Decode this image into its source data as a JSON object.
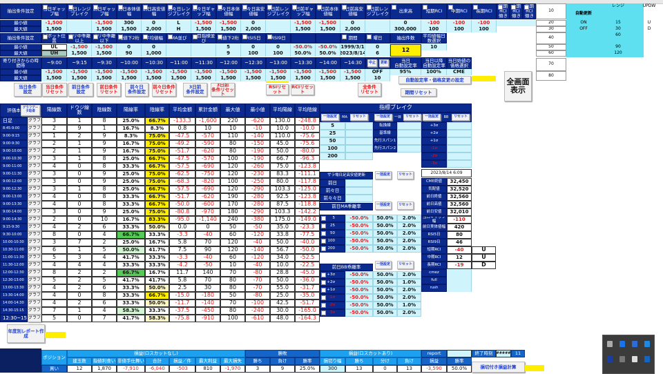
{
  "top": {
    "min_label": "最小値",
    "max_label": "最大値",
    "cond1": {
      "label": "抽出条件設定",
      "headers": [
        "当日ギャップ幅",
        "当日レンジブレイク",
        "前日ギャップ幅",
        "前日本体値幅",
        "前日高安値幅",
        "前々日レンジブレイク",
        "前々日ギャップ幅",
        "前々日本体値幅",
        "前々日高安値幅",
        "3日前レンジブレイク",
        "3日前ギャップ幅",
        "3日前本体値幅",
        "3日前高安値幅",
        "3日前レンジブレイク",
        "出来高",
        "短期RCI",
        "中期RCI",
        "長期RCI",
        "短期RCI傾き",
        "中期RCI傾き",
        "長期RCI傾き"
      ],
      "min": [
        "-1,500",
        "",
        "-1,500",
        "300",
        "0",
        "L",
        "-1,500",
        "-1,500",
        "0",
        "",
        "-1,500",
        "-1,500",
        "0",
        "",
        "0",
        "-100",
        "-100",
        "-100",
        "",
        "",
        ""
      ],
      "max": [
        "1,500",
        "",
        "1,500",
        "1,500",
        "2,000",
        "H",
        "1,500",
        "1,500",
        "2,000",
        "",
        "1,500",
        "1,500",
        "2,000",
        "",
        "300,000",
        "100",
        "100",
        "100",
        "",
        "",
        ""
      ]
    },
    "cond2": {
      "label": "抽出条件設定",
      "headers": [
        "ピボット位置",
        "ボリ中乖離以上",
        "ボリ中乖離以下",
        "始値下2桁",
        "平均値幅",
        "MA並び",
        "一目指標並び",
        "終値下2桁",
        "RSI5日",
        "RSI9日",
        "",
        "",
        "期間",
        "曜日",
        "抽出件数",
        "平均値幅日数選択"
      ],
      "min": [
        "UL",
        "-1,500",
        "-1,500",
        "0",
        "0",
        "",
        "",
        "5",
        "0",
        "0",
        "-50.0%",
        "-50.0%",
        "1999/3/1",
        "0",
        "12",
        "10"
      ],
      "max": [
        "UH",
        "1,500",
        "1,500",
        "90",
        "1,000",
        "",
        "",
        "9",
        "100",
        "100",
        "50.0%",
        "50.0%",
        "2023/8/14",
        "6",
        "",
        ""
      ]
    },
    "time": {
      "label": "寄り付きからの時間帯",
      "headers": [
        "~9:00",
        "~9:15",
        "~9:30",
        "~10:00",
        "~10:30",
        "~11:00",
        "~11:30",
        "~12:00",
        "~12:30",
        "~13:00",
        "~13:30",
        "~14:00",
        "~14:30"
      ],
      "min": [
        "-1,500",
        "-1,500",
        "-1,500",
        "-1,500",
        "-1,500",
        "-1,500",
        "-1,500",
        "-1,500",
        "-1,500",
        "-1,500",
        "-1,500",
        "-1,500",
        "-1,500"
      ],
      "max": [
        "1,500",
        "1,500",
        "1,500",
        "1,500",
        "1,500",
        "1,500",
        "1,500",
        "1,500",
        "1,500",
        "1,500",
        "1,500",
        "1,500",
        "1,500"
      ],
      "stop_label": "中止",
      "update_label": "更新",
      "switch_value": "OFF",
      "switch_max": "10",
      "auto_today_label": "当日\n自動設定率",
      "auto_today_value": "95%",
      "auto_after_label": "当日以降\n自動設定率",
      "auto_after_value": "100%",
      "open_price_label": "当日始値の価格選択",
      "open_price_value": "CME"
    },
    "buttons": [
      "当日条件\n設定",
      "当日条件\nリセット",
      "前日条件\n設定",
      "前日条件\nリセット",
      "前々日\n条件設定",
      "前々日条件\nリセット",
      "3日前\n条件設定",
      "3日前\n条件リセット",
      "RSIリセット",
      "RCIリセット",
      "全条件\nリセット",
      "自動設定率・価格変更の設定",
      "期間リセット",
      "全画面\n表示"
    ]
  },
  "side": {
    "w_values": [
      "10",
      "20",
      "30",
      "40",
      "50",
      "60",
      "70",
      "80"
    ],
    "auto_update_label": "自動更新",
    "auto_update_options": [
      "ON",
      "OFF"
    ],
    "range_label": "レンジ",
    "range_values": [
      "15",
      "30",
      "60",
      "90",
      "120"
    ],
    "updw_label": "UPDW",
    "updw_values": [
      "U",
      "D"
    ]
  },
  "main": {
    "corner_label": "評価本",
    "graph_data_button": "グラフデータ取得",
    "graph_button": "グラフ",
    "columns": [
      "陽線数",
      "ドウジ線数",
      "陰線数",
      "陽線率",
      "陰線率",
      "平均金額",
      "累計金額",
      "最大値",
      "最小値",
      "平均陽線",
      "平均陰線"
    ],
    "rows": [
      [
        "日足",
        "3",
        "1",
        "8",
        "25.0%",
        "66.7%",
        "-133.3",
        "-1,600",
        "220",
        "-620",
        "130.0",
        "-248.8"
      ],
      [
        "8:45-9:00",
        "2",
        "9",
        "1",
        "16.7%",
        "8.3%",
        "0.8",
        "10",
        "10",
        "-10",
        "10.0",
        "-10.0"
      ],
      [
        "9:00-9:15",
        "1",
        "2",
        "9",
        "8.3%",
        "75.0%",
        "-47.5",
        "-570",
        "110",
        "-140",
        "110.0",
        "-75.6"
      ],
      [
        "9:00-9:30",
        "2",
        "1",
        "9",
        "16.7%",
        "75.0%",
        "-49.2",
        "-590",
        "80",
        "-150",
        "45.0",
        "-75.6"
      ],
      [
        "9:00-10:00",
        "2",
        "1",
        "9",
        "16.7%",
        "75.0%",
        "-51.7",
        "-620",
        "80",
        "-190",
        "50.0",
        "-80.0"
      ],
      [
        "9:00-10:30",
        "3",
        "1",
        "8",
        "25.0%",
        "66.7%",
        "-47.5",
        "-570",
        "100",
        "-190",
        "66.7",
        "-96.3"
      ],
      [
        "9:00-11:00",
        "4",
        "0",
        "8",
        "33.3%",
        "66.7%",
        "-57.5",
        "-690",
        "120",
        "-260",
        "75.0",
        "-123.8"
      ],
      [
        "9:00-11:30",
        "3",
        "0",
        "9",
        "25.0%",
        "75.0%",
        "-62.5",
        "-750",
        "120",
        "-230",
        "83.3",
        "-111.1"
      ],
      [
        "9:00-12:00",
        "3",
        "0",
        "9",
        "25.0%",
        "75.0%",
        "-68.3",
        "-820",
        "100",
        "-250",
        "80.0",
        "-117.8"
      ],
      [
        "9:00-12:30",
        "3",
        "1",
        "8",
        "25.0%",
        "66.7%",
        "-57.5",
        "-690",
        "120",
        "-290",
        "103.3",
        "-125.0"
      ],
      [
        "9:00-13:00",
        "4",
        "0",
        "8",
        "33.3%",
        "66.7%",
        "-51.7",
        "-620",
        "190",
        "-280",
        "92.5",
        "-123.8"
      ],
      [
        "9:00-13:30",
        "4",
        "0",
        "8",
        "33.3%",
        "66.7%",
        "-50.0",
        "-600",
        "170",
        "-280",
        "87.5",
        "-118.8"
      ],
      [
        "9:00-14:00",
        "3",
        "0",
        "9",
        "25.0%",
        "75.0%",
        "-80.8",
        "-970",
        "180",
        "-290",
        "103.3",
        "-142.2"
      ],
      [
        "9:00-14:30",
        "2",
        "0",
        "10",
        "16.7%",
        "83.3%",
        "-95.0",
        "-1,140",
        "240",
        "-380",
        "175.0",
        "-149.0"
      ],
      [
        "9:15-9:30",
        "4",
        "2",
        "6",
        "33.3%",
        "50.0%",
        "0.0",
        "0",
        "50",
        "-50",
        "35.0",
        "-23.3"
      ],
      [
        "9:30-10:00",
        "8",
        "0",
        "4",
        "66.7%",
        "33.3%",
        "-3.3",
        "-40",
        "60",
        "-120",
        "33.8",
        "-77.5"
      ],
      [
        "10:00-10:30",
        "3",
        "7",
        "2",
        "25.0%",
        "16.7%",
        "5.8",
        "70",
        "120",
        "-40",
        "50.0",
        "-40.0"
      ],
      [
        "10:30-11:00",
        "6",
        "1",
        "5",
        "50.0%",
        "41.7%",
        "7.5",
        "90",
        "120",
        "-140",
        "56.7",
        "-50.0"
      ],
      [
        "11:00-11:30",
        "5",
        "3",
        "4",
        "41.7%",
        "33.3%",
        "-3.3",
        "-40",
        "60",
        "-120",
        "34.0",
        "-52.5"
      ],
      [
        "11:30-12:00",
        "4",
        "4",
        "4",
        "33.3%",
        "33.3%",
        "-4.2",
        "-50",
        "10",
        "-40",
        "10.0",
        "-22.5"
      ],
      [
        "12:00-12:30",
        "8",
        "2",
        "2",
        "66.7%",
        "16.7%",
        "11.7",
        "140",
        "70",
        "-80",
        "28.8",
        "-45.0"
      ],
      [
        "12:30-13:00",
        "5",
        "2",
        "5",
        "41.7%",
        "41.7%",
        "5.8",
        "70",
        "80",
        "-70",
        "50.0",
        "-36.0"
      ],
      [
        "13:00-13:30",
        "4",
        "2",
        "6",
        "33.3%",
        "50.0%",
        "2.5",
        "30",
        "80",
        "-70",
        "55.0",
        "-31.7"
      ],
      [
        "13:30-14:00",
        "4",
        "0",
        "8",
        "33.3%",
        "66.7%",
        "-15.0",
        "-180",
        "50",
        "-80",
        "25.0",
        "-35.0"
      ],
      [
        "14:00-14:30",
        "4",
        "2",
        "6",
        "33.3%",
        "50.0%",
        "-11.7",
        "-140",
        "70",
        "-100",
        "42.5",
        "-51.7"
      ],
      [
        "14:30-15:15",
        "7",
        "1",
        "4",
        "58.3%",
        "33.3%",
        "-37.5",
        "-450",
        "80",
        "-240",
        "30.0",
        "-165.0"
      ],
      [
        "12:30~15:15",
        "5",
        "0",
        "7",
        "41.7%",
        "58.3%",
        "-75.8",
        "-910",
        "100",
        "-610",
        "48.0",
        "-164.3"
      ]
    ]
  },
  "indicator": {
    "title": "指標ブレイク",
    "bulk_label": "一括設定",
    "reset_label": "リセット",
    "ma_label": "MA",
    "ichimoku_label": "一目",
    "bb_label": "BB",
    "ma_rows": [
      "5",
      "25",
      "50",
      "100",
      "200"
    ],
    "ichimoku_rows": [
      "転換線",
      "基準線",
      "先行スパン1",
      "先行スパン2"
    ],
    "bb_rows": [
      "+3σ",
      "+2σ",
      "+1σ",
      "-1σ",
      "-2σ",
      "-3σ"
    ],
    "zaraba_label": "ザラ場日足高安値更新",
    "zaraba_rows": [
      "前日",
      "前々日",
      "前々々日"
    ],
    "timestamp": "2023/8/14 6:09",
    "prices": [
      {
        "label": "CME終値",
        "value": "32,450",
        "extra": ""
      },
      {
        "label": "気配値",
        "value": "32,520",
        "extra": ""
      },
      {
        "label": "前日終値",
        "value": "32,560",
        "extra": ""
      },
      {
        "label": "前日高値",
        "value": "32,560",
        "extra": ""
      },
      {
        "label": "前日安値",
        "value": "32,010",
        "extra": ""
      },
      {
        "label": "当日ギャップ幅",
        "value": "-110",
        "extra": ""
      },
      {
        "label": "前日実体値幅",
        "value": "420",
        "extra": ""
      },
      {
        "label": "RSI5日",
        "value": "80",
        "extra": ""
      },
      {
        "label": "RSI9日",
        "value": "46",
        "extra": ""
      },
      {
        "label": "短期RCI",
        "value": "-40",
        "extra": "U"
      },
      {
        "label": "中期RCI",
        "value": "12",
        "extra": "U"
      },
      {
        "label": "長期RCI",
        "value": "-19",
        "extra": "D"
      },
      {
        "label": "cmez",
        "value": "",
        "extra": ""
      },
      {
        "label": "full",
        "value": "",
        "extra": ""
      },
      {
        "label": "rush",
        "value": "",
        "extra": ""
      }
    ],
    "ma_dev_label": "前日MA乖離率",
    "ma_dev_rows": [
      [
        "5",
        "-50.0%",
        "50.0%",
        "2.0%"
      ],
      [
        "25",
        "-50.0%",
        "50.0%",
        "2.0%"
      ],
      [
        "50",
        "-50.0%",
        "50.0%",
        "2.0%"
      ],
      [
        "100",
        "-50.0%",
        "50.0%",
        "2.0%"
      ],
      [
        "200",
        "-50.0%",
        "50.0%",
        "2.0%"
      ]
    ],
    "bb_dev_label": "前日BB乖離率",
    "bb_dev_rows": [
      [
        "+3σ",
        "-50.0%",
        "50.0%",
        "2.0%"
      ],
      [
        "+2σ",
        "-50.0%",
        "50.0%",
        "1.0%"
      ],
      [
        "+1σ",
        "-50.0%",
        "50.0%",
        "2.0%"
      ],
      [
        "-1σ",
        "-50.0%",
        "50.0%",
        "2.0%"
      ],
      [
        "-2σ",
        "-50.0%",
        "50.0%",
        "1.0%"
      ],
      [
        "-3σ",
        "-50.0%",
        "50.0%",
        "2.0%"
      ]
    ]
  },
  "bottom": {
    "yearly_report_button": "年度別レポート作成",
    "position_label": "ポジション",
    "group_no_losscut": "損益(ロスカットなし)",
    "group_winloss": "勝敗",
    "group_losscut": "損益(ロスカットあり)",
    "report_label": "report",
    "report_value": "",
    "end_time_label": "終了時刻",
    "end_time_value": "#####",
    "end_time_extra": "11",
    "columns": [
      "建玉数",
      "指値利食い",
      "非値手仕舞い",
      "合計",
      "損益／件",
      "最大利益",
      "最大損失",
      "勝ち",
      "負け",
      "勝率",
      "損切り幅",
      "勝ち",
      "分け",
      "負け",
      "損益",
      "勝率"
    ],
    "row_label": "買い",
    "row": [
      "12",
      "1,870",
      "-7,910",
      "-6,040",
      "-503",
      "810",
      "-1,970",
      "3",
      "9",
      "25.0%",
      "300",
      "13",
      "0",
      "13",
      "-3,590",
      "50.0%"
    ],
    "losscut_calc_button": "損切付き損益計算"
  },
  "colors": {
    "header": "#0b2a8f",
    "cell": "#cff4fb",
    "strong_yellow": "#ffee00",
    "light_yellow": "#fff8c0",
    "strong_green": "#55cc55",
    "light_green": "#d6f5d6",
    "negative": "#e31b1b"
  },
  "tray_icons": [
    "usb-icon",
    "remote-icon",
    "display-icon",
    "bluetooth-icon",
    "app-icon",
    "network-icon",
    "microphone-icon",
    "outlook-icon"
  ]
}
